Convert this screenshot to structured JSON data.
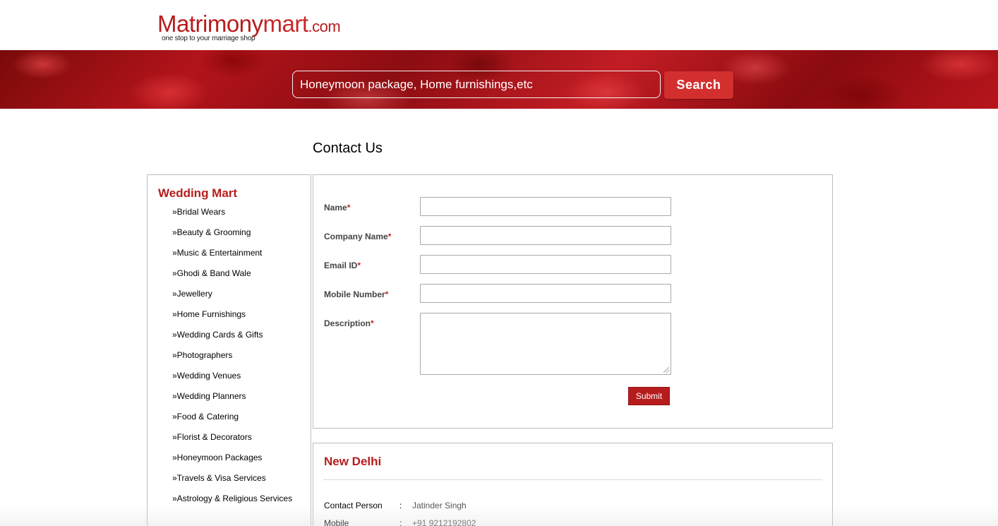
{
  "logo": {
    "part1": "Matrimony",
    "part2": "mart",
    "part3": ".com",
    "tagline": "one stop to your marriage shop"
  },
  "search": {
    "placeholder": "Honeymoon package, Home furnishings,etc",
    "button_label": "Search"
  },
  "page_title": "Contact Us",
  "sidebar": {
    "title": "Wedding Mart",
    "items": [
      "»Bridal Wears",
      "»Beauty & Grooming",
      "»Music & Entertainment",
      "»Ghodi & Band Wale",
      "»Jewellery",
      "»Home Furnishings",
      "»Wedding Cards & Gifts",
      "»Photographers",
      "»Wedding Venues",
      "»Wedding Planners",
      "»Food & Catering",
      "»Florist & Decorators",
      "»Honeymoon Packages",
      "»Travels & Visa Services",
      "»Astrology & Religious Services"
    ]
  },
  "form": {
    "fields": [
      {
        "label": "Name",
        "required_mark": "*",
        "value": ""
      },
      {
        "label": "Company Name",
        "required_mark": "*",
        "value": ""
      },
      {
        "label": "Email ID",
        "required_mark": "*",
        "value": ""
      },
      {
        "label": "Mobile Number",
        "required_mark": "*",
        "value": ""
      },
      {
        "label": "Description",
        "required_mark": "*",
        "value": ""
      }
    ],
    "submit_label": "Submit"
  },
  "contact": {
    "city": "New Delhi",
    "separator": ":",
    "rows": [
      {
        "key": "Contact Person",
        "value": "Jatinder Singh"
      },
      {
        "key": "Mobile",
        "value": "+91 9212192802"
      }
    ]
  },
  "colors": {
    "brand_red": "#b71c1c",
    "button_red": "#d32f2f"
  }
}
